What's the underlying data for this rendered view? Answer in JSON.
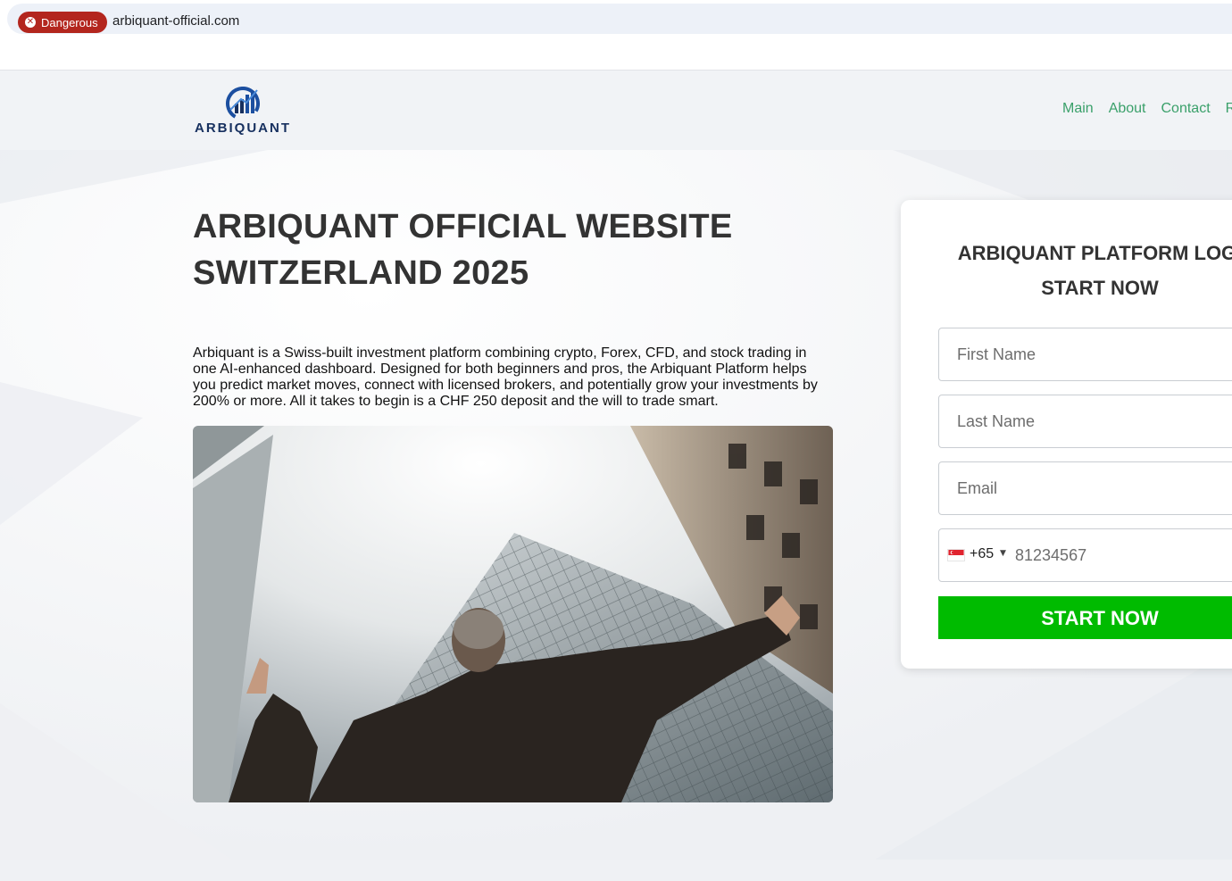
{
  "browser": {
    "security_label": "Dangerous",
    "url": "arbiquant-official.com"
  },
  "header": {
    "logo_text": "ARBIQUANT",
    "nav": [
      "Main",
      "About",
      "Contact",
      "R"
    ]
  },
  "hero": {
    "headline_line1": "ARBIQUANT OFFICIAL WEBSITE",
    "headline_line2": "SWITZERLAND 2025",
    "intro_line1": "Arbiquant is a Swiss-built investment platform combining crypto, Forex, CFD, and stock trading in",
    "intro_line2": "one AI-enhanced dashboard. Designed for both beginners and pros, the Arbiquant Platform helps",
    "intro_line3": "you predict market moves, connect with licensed brokers, and potentially grow your investments by",
    "intro_line4": "200% or more. All it takes to begin is a CHF 250 deposit and the will to trade smart."
  },
  "form": {
    "title_line1": "ARBIQUANT PLATFORM LOGI",
    "title_line2": "START NOW",
    "first_name_placeholder": "First Name",
    "last_name_placeholder": "Last Name",
    "email_placeholder": "Email",
    "phone_code": "+65",
    "phone_placeholder": "81234567",
    "submit_label": "START NOW"
  },
  "colors": {
    "danger": "#b3261e",
    "nav_link": "#3aa06a",
    "cta": "#00bb00",
    "heading": "#333333",
    "logo": "#17305f"
  }
}
